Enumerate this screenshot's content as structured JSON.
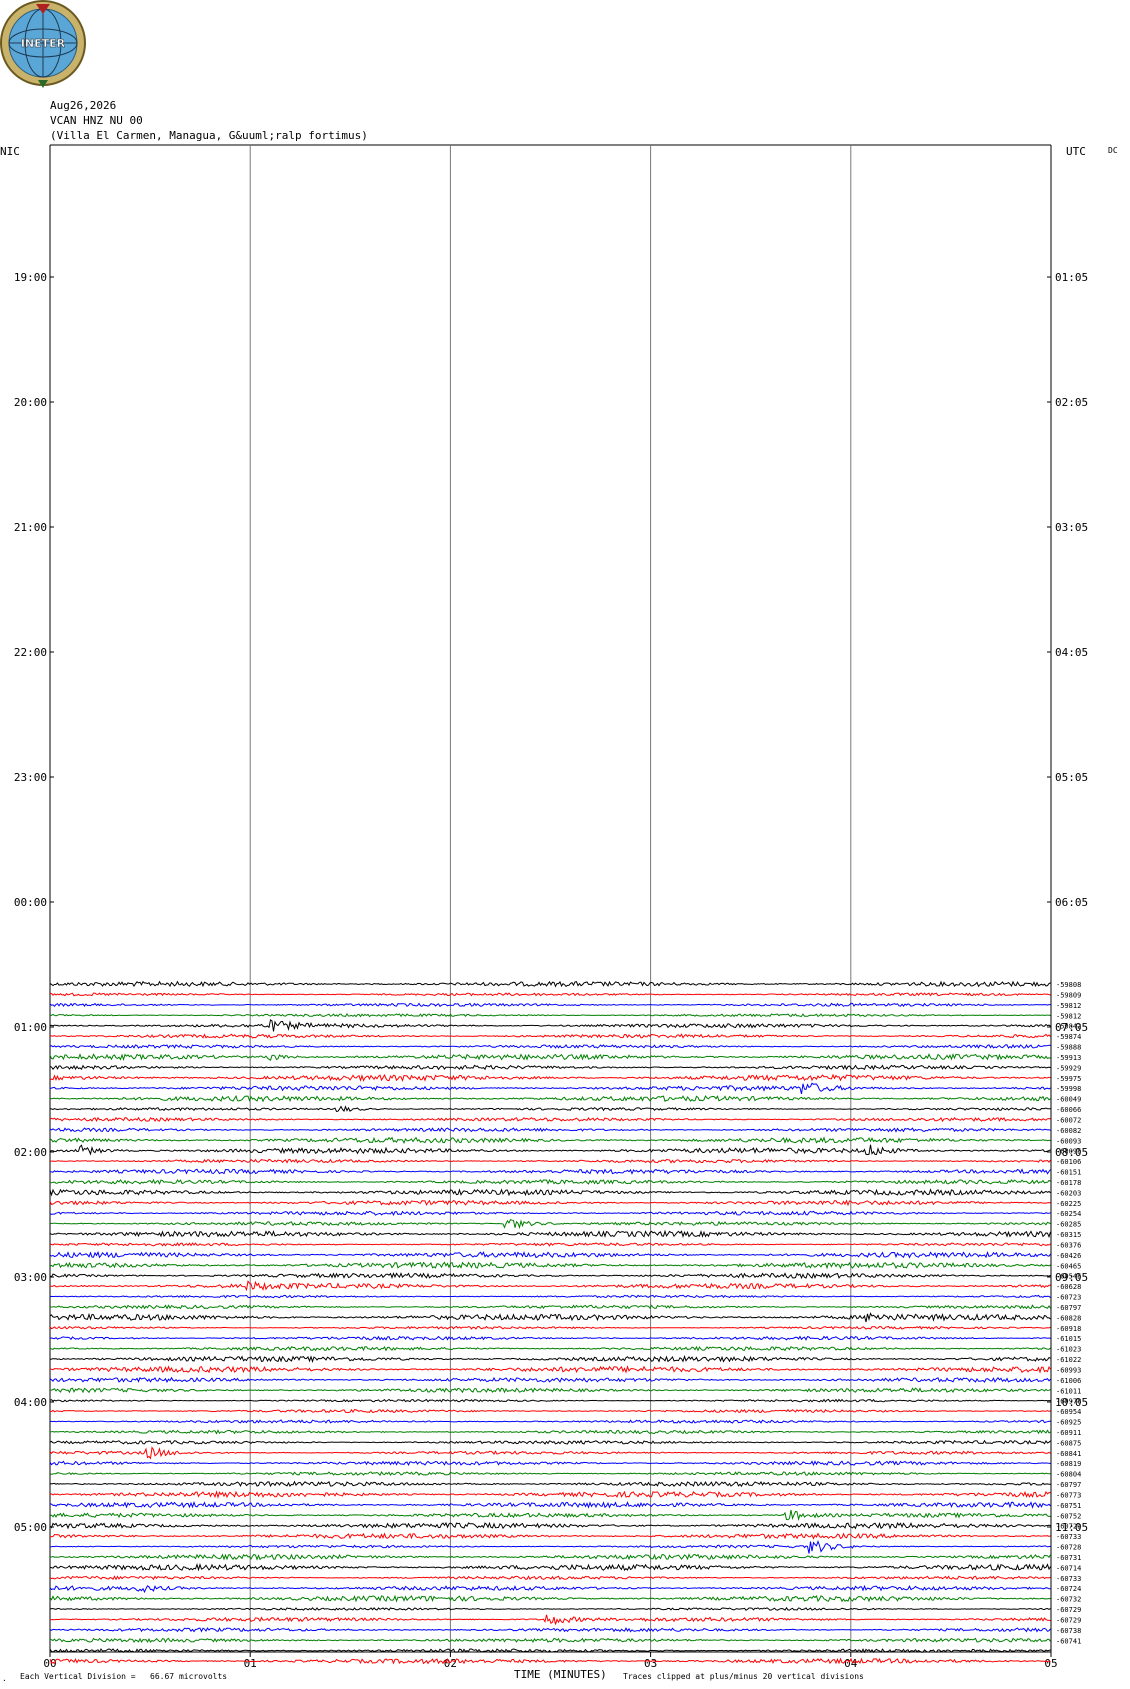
{
  "logo": {
    "text": "INETER"
  },
  "header": {
    "date": "Aug26,2026",
    "station": "VCAN HNZ NU 00",
    "location": "(Villa El Carmen, Managua, G&uuml;ralp fortimus)"
  },
  "left_axis_title": "NIC",
  "right_axis_title": "UTC",
  "dc_label": "DC",
  "footer": {
    "scale": "Each Vertical Division =   66.67 microvolts",
    "xlabel": "TIME (MINUTES)",
    "clip_note": "Traces clipped at plus/minus 20 vertical divisions",
    "corner_mark": "·"
  },
  "colors": [
    "#000000",
    "#ff0000",
    "#0000ff",
    "#008000"
  ],
  "chart_data": {
    "type": "line",
    "title": "",
    "xlabel": "TIME (MINUTES)",
    "ylabel": "",
    "x_ticks": [
      "00",
      "01",
      "02",
      "03",
      "04",
      "05"
    ],
    "xlim": [
      0,
      5
    ],
    "left_time_labels": [
      "19:00",
      "20:00",
      "21:00",
      "22:00",
      "23:00",
      "00:00",
      "01:00",
      "02:00",
      "03:00",
      "04:00",
      "05:00"
    ],
    "right_time_labels": [
      "01:05",
      "02:05",
      "03:05",
      "04:05",
      "05:05",
      "06:05",
      "07:05",
      "08:05",
      "09:05",
      "10:05",
      "11:05"
    ],
    "trace_count": 66,
    "first_trace_start_min": 0.0,
    "first_trace_black_gap_until_min": 3.0,
    "trace_dc_offsets": [
      "-59808",
      "-59809",
      "-59812",
      "-59812",
      "-59842",
      "-59874",
      "-59888",
      "-59913",
      "-59929",
      "-59975",
      "-59998",
      "-60049",
      "-60066",
      "-60072",
      "-60082",
      "-60093",
      "-60095",
      "-60106",
      "-60151",
      "-60178",
      "-60203",
      "-60225",
      "-60254",
      "-60285",
      "-60315",
      "-60376",
      "-60426",
      "-60465",
      "-60545",
      "-60628",
      "-60723",
      "-60797",
      "-60828",
      "-60918",
      "-61015",
      "-61023",
      "-61022",
      "-60993",
      "-61006",
      "-61011",
      "-60978",
      "-60954",
      "-60925",
      "-60911",
      "-60875",
      "-60841",
      "-60819",
      "-60804",
      "-60797",
      "-60773",
      "-60751",
      "-60752",
      "-60729",
      "-60733",
      "-60728",
      "-60731",
      "-60714",
      "-60733",
      "-60724",
      "-60732",
      "-60729",
      "-60729",
      "-60738",
      "-60741"
    ],
    "events": [
      {
        "trace": 4,
        "minute": 1.12,
        "amplitude": 4
      },
      {
        "trace": 7,
        "minute": 1.1,
        "amplitude": 3
      },
      {
        "trace": 10,
        "minute": 3.78,
        "amplitude": 5
      },
      {
        "trace": 12,
        "minute": 1.45,
        "amplitude": 3
      },
      {
        "trace": 16,
        "minute": 0.15,
        "amplitude": 5
      },
      {
        "trace": 16,
        "minute": 4.1,
        "amplitude": 5
      },
      {
        "trace": 23,
        "minute": 2.3,
        "amplitude": 6
      },
      {
        "trace": 29,
        "minute": 1.0,
        "amplitude": 3
      },
      {
        "trace": 32,
        "minute": 4.1,
        "amplitude": 3
      },
      {
        "trace": 45,
        "minute": 0.5,
        "amplitude": 5
      },
      {
        "trace": 51,
        "minute": 3.7,
        "amplitude": 5
      },
      {
        "trace": 54,
        "minute": 3.82,
        "amplitude": 6
      },
      {
        "trace": 58,
        "minute": 0.45,
        "amplitude": 3
      },
      {
        "trace": 61,
        "minute": 2.5,
        "amplitude": 6
      }
    ]
  }
}
